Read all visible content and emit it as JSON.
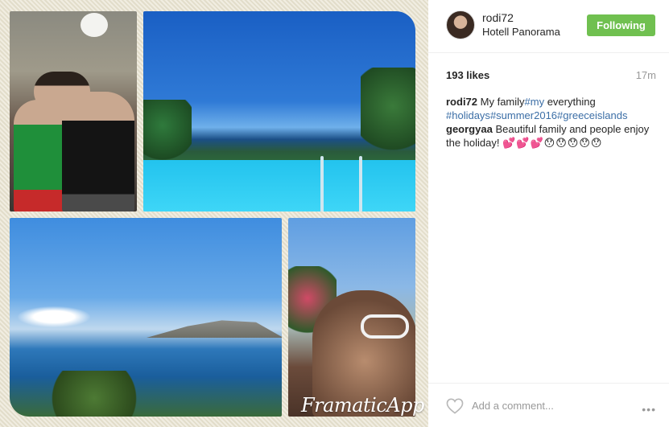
{
  "post": {
    "username": "rodi72",
    "location": "Hotell Panorama",
    "follow_label": "Following",
    "likes": "193 likes",
    "time": "17m",
    "caption": {
      "user": "rodi72",
      "text": "My family",
      "tag1": "#my",
      "text2": " everything ",
      "tag2": "#holidays",
      "tag3": "#summer2016",
      "tag4": "#greeceislands"
    },
    "comment": {
      "user": "georgyaa",
      "text": "Beautiful family and people enjoy the holiday!",
      "emoji": "💕💕💕😯😯😯😯😯"
    },
    "add_comment_placeholder": "Add a comment...",
    "more_label": "•••",
    "watermark": "FramaticApp"
  },
  "colors": {
    "follow_button": "#70c050",
    "hashtag": "#3b6ea6",
    "muted": "#999999"
  },
  "icons": {
    "like": "heart-outline-icon",
    "more": "ellipsis-icon"
  }
}
